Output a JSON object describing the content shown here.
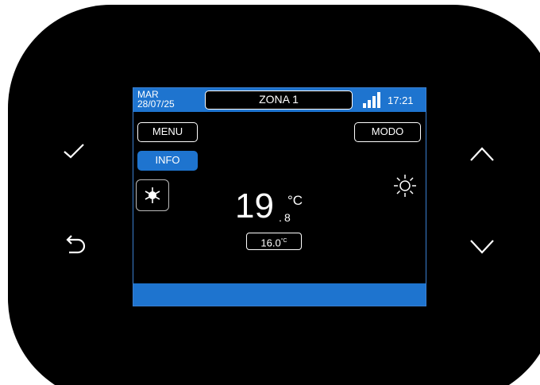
{
  "colors": {
    "accent": "#1e74cf",
    "screen_bg": "#000000",
    "device": "#000000",
    "text": "#ffffff"
  },
  "status_bar": {
    "day": "MAR",
    "date": "28/07/25",
    "zone": "ZONA 1",
    "time": "17:21",
    "signal_icon": "signal-bars-icon"
  },
  "buttons": {
    "menu": "MENU",
    "info": "INFO",
    "mode": "MODO"
  },
  "temperature": {
    "integer": "19",
    "decimal": "8",
    "unit": "°C"
  },
  "setpoint": {
    "value": "16.0",
    "unit": "°C"
  },
  "icons": {
    "mode": "snowflake-sun-icon",
    "weather": "sun-icon"
  },
  "hardware_buttons": [
    "confirm-check-icon",
    "back-arrow-icon",
    "up-chevron-icon",
    "down-chevron-icon"
  ]
}
